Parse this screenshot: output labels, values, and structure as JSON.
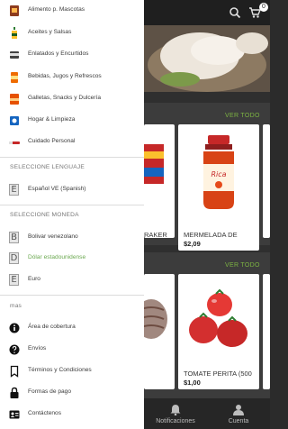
{
  "topbar": {
    "cart_count": "0"
  },
  "sections": [
    {
      "see_all": "VER TODO"
    },
    {
      "see_all": "VER TODO"
    }
  ],
  "products": [
    {
      "name": "RAKER",
      "price": ""
    },
    {
      "name": "MERMELADA DE",
      "price": "$2,09"
    },
    {
      "name": "TOMATE PERITA (500",
      "price": "$1,00"
    }
  ],
  "bottom_nav": {
    "notifications": "Notificaciones",
    "account": "Cuenta"
  },
  "drawer": {
    "categories": [
      {
        "label": "Alimento p. Mascotas",
        "icon": "pet-food-icon"
      },
      {
        "label": "Aceites y Salsas",
        "icon": "oil-bottle-icon"
      },
      {
        "label": "Enlatados y Encurtidos",
        "icon": "canned-food-icon"
      },
      {
        "label": "Bebidas, Jugos y Refrescos",
        "icon": "beverage-icon"
      },
      {
        "label": "Galletas, Snacks y Dulcería",
        "icon": "snacks-icon"
      },
      {
        "label": "Hogar & Limpieza",
        "icon": "cleaning-icon"
      },
      {
        "label": "Cuidado Personal",
        "icon": "personal-care-icon"
      }
    ],
    "language_title": "SELECCIONE LENGUAJE",
    "languages": [
      {
        "letter": "E",
        "label": "Español VE (Spanish)"
      }
    ],
    "currency_title": "SELECCIONE MONEDA",
    "currencies": [
      {
        "letter": "B",
        "label": "Bolivar venezolano",
        "selected": false
      },
      {
        "letter": "D",
        "label": "Dólar estadounidense",
        "selected": true
      },
      {
        "letter": "E",
        "label": "Euro",
        "selected": false
      }
    ],
    "more_title": "mas",
    "more_items": [
      {
        "label": "Área de cobertura",
        "icon": "info-icon"
      },
      {
        "label": "Envíos",
        "icon": "help-icon"
      },
      {
        "label": "Términos y Condiciones",
        "icon": "bookmark-icon"
      },
      {
        "label": "Formas de pago",
        "icon": "lock-icon"
      },
      {
        "label": "Contáctenos",
        "icon": "contact-card-icon"
      }
    ]
  },
  "colors": {
    "accent_green": "#7cb342",
    "drawer_bg": "#ffffff",
    "app_bg": "#2f2f2f"
  }
}
